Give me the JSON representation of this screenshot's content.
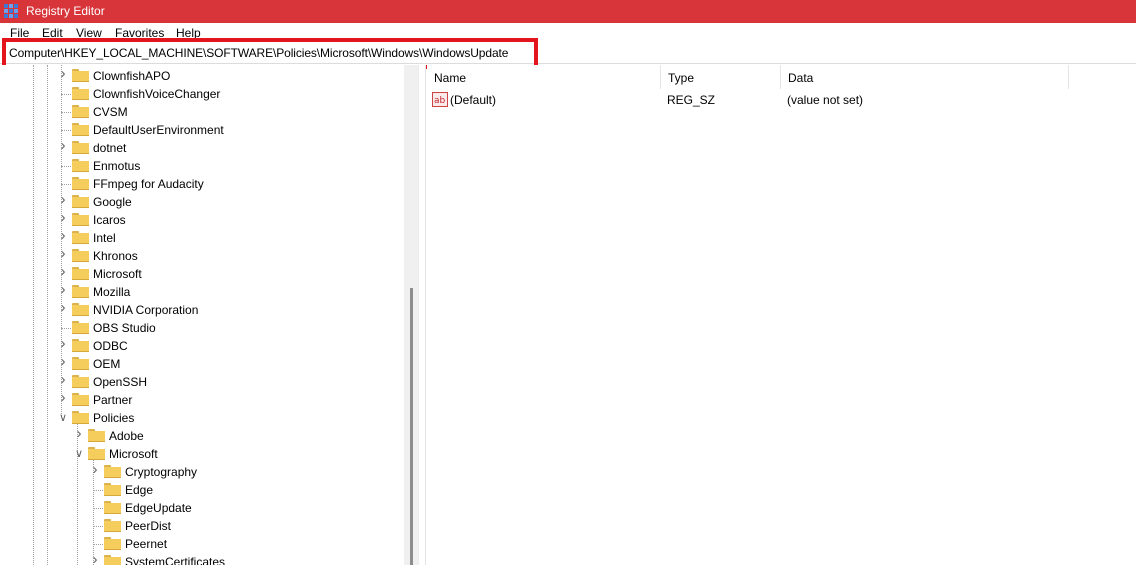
{
  "window": {
    "title": "Registry Editor"
  },
  "menu": [
    "File",
    "Edit",
    "View",
    "Favorites",
    "Help"
  ],
  "address": {
    "path": "Computer\\HKEY_LOCAL_MACHINE\\SOFTWARE\\Policies\\Microsoft\\Windows\\WindowsUpdate"
  },
  "tree": [
    {
      "label": "ClownfishAPO",
      "level": 0,
      "expander": "collapsed"
    },
    {
      "label": "ClownfishVoiceChanger",
      "level": 0,
      "expander": "none"
    },
    {
      "label": "CVSM",
      "level": 0,
      "expander": "none"
    },
    {
      "label": "DefaultUserEnvironment",
      "level": 0,
      "expander": "none"
    },
    {
      "label": "dotnet",
      "level": 0,
      "expander": "collapsed"
    },
    {
      "label": "Enmotus",
      "level": 0,
      "expander": "none"
    },
    {
      "label": "FFmpeg for Audacity",
      "level": 0,
      "expander": "none"
    },
    {
      "label": "Google",
      "level": 0,
      "expander": "collapsed"
    },
    {
      "label": "Icaros",
      "level": 0,
      "expander": "collapsed"
    },
    {
      "label": "Intel",
      "level": 0,
      "expander": "collapsed"
    },
    {
      "label": "Khronos",
      "level": 0,
      "expander": "collapsed"
    },
    {
      "label": "Microsoft",
      "level": 0,
      "expander": "collapsed"
    },
    {
      "label": "Mozilla",
      "level": 0,
      "expander": "collapsed"
    },
    {
      "label": "NVIDIA Corporation",
      "level": 0,
      "expander": "collapsed"
    },
    {
      "label": "OBS Studio",
      "level": 0,
      "expander": "none"
    },
    {
      "label": "ODBC",
      "level": 0,
      "expander": "collapsed"
    },
    {
      "label": "OEM",
      "level": 0,
      "expander": "collapsed"
    },
    {
      "label": "OpenSSH",
      "level": 0,
      "expander": "collapsed"
    },
    {
      "label": "Partner",
      "level": 0,
      "expander": "collapsed"
    },
    {
      "label": "Policies",
      "level": 0,
      "expander": "expanded"
    },
    {
      "label": "Adobe",
      "level": 1,
      "expander": "collapsed"
    },
    {
      "label": "Microsoft",
      "level": 1,
      "expander": "expanded"
    },
    {
      "label": "Cryptography",
      "level": 2,
      "expander": "collapsed"
    },
    {
      "label": "Edge",
      "level": 2,
      "expander": "none"
    },
    {
      "label": "EdgeUpdate",
      "level": 2,
      "expander": "none"
    },
    {
      "label": "PeerDist",
      "level": 2,
      "expander": "none"
    },
    {
      "label": "Peernet",
      "level": 2,
      "expander": "none"
    },
    {
      "label": "SystemCertificates",
      "level": 2,
      "expander": "collapsed"
    }
  ],
  "values_table": {
    "columns": [
      "Name",
      "Type",
      "Data"
    ],
    "rows": [
      {
        "name": "(Default)",
        "type": "REG_SZ",
        "data": "(value not set)",
        "icon": "string-value-icon"
      }
    ]
  },
  "colors": {
    "titlebar": "#d7353a",
    "highlight": "#e3141b",
    "folder": "#f5cd5d"
  }
}
